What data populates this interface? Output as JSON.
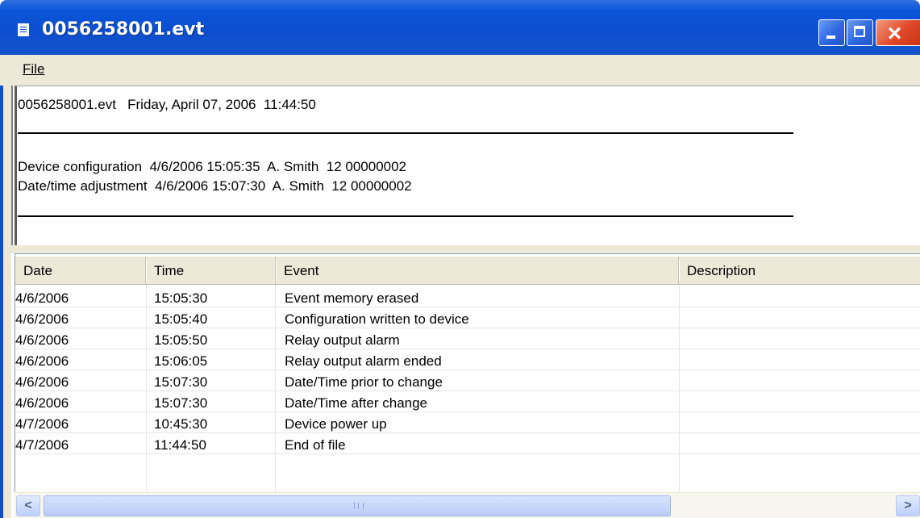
{
  "window": {
    "title": "0056258001.evt",
    "icon": "document-icon",
    "minimize_icon": "minimize-icon",
    "maximize_icon": "maximize-icon",
    "close_icon": "close-icon",
    "title_color": "#0d4fd0",
    "close_color": "#e0482a"
  },
  "menu": {
    "file_label": "File"
  },
  "header_text": {
    "line1": "0056258001.evt   Friday, April 07, 2006  11:44:50",
    "entries": [
      "Device configuration  4/6/2006 15:05:35  A. Smith  12 00000002",
      "Date/time adjustment  4/6/2006 15:07:30  A. Smith  12 00000002"
    ]
  },
  "table": {
    "columns": [
      "Date",
      "Time",
      "Event",
      "Description"
    ],
    "rows": [
      {
        "date": "4/6/2006",
        "time": "15:05:30",
        "event": "Event memory erased",
        "description": ""
      },
      {
        "date": "4/6/2006",
        "time": "15:05:40",
        "event": "Configuration written to device",
        "description": ""
      },
      {
        "date": "4/6/2006",
        "time": "15:05:50",
        "event": "Relay output alarm",
        "description": ""
      },
      {
        "date": "4/6/2006",
        "time": "15:06:05",
        "event": "Relay output alarm ended",
        "description": ""
      },
      {
        "date": "4/6/2006",
        "time": "15:07:30",
        "event": "Date/Time prior to change",
        "description": ""
      },
      {
        "date": "4/6/2006",
        "time": "15:07:30",
        "event": "Date/Time after change",
        "description": ""
      },
      {
        "date": "4/7/2006",
        "time": "10:45:30",
        "event": "Device power up",
        "description": ""
      },
      {
        "date": "4/7/2006",
        "time": "11:44:50",
        "event": "End of file",
        "description": ""
      }
    ]
  },
  "scrollbar": {
    "left_icon": "scroll-left-arrow-icon",
    "right_icon": "scroll-right-arrow-icon"
  }
}
